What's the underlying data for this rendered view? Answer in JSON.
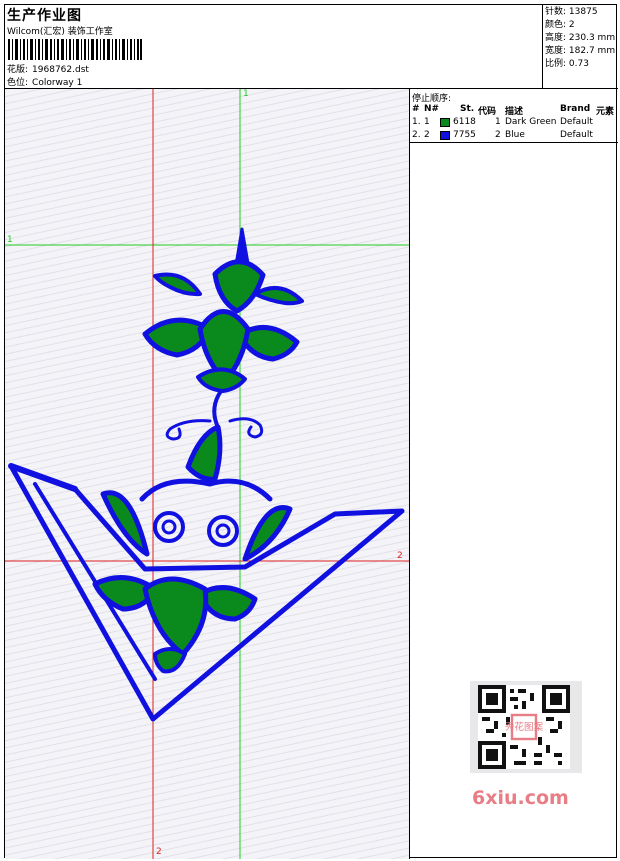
{
  "header": {
    "title": "生产作业图",
    "subtitle": "Wilcom(汇宏) 装饰工作室",
    "design_label": "花版:",
    "design_value": "1968762.dst",
    "colorway_label": "色位:",
    "colorway_value": "Colorway 1"
  },
  "stats": [
    {
      "label": "针数:",
      "value": "13875"
    },
    {
      "label": "颜色:",
      "value": "2"
    },
    {
      "label": "高度:",
      "value": "230.3 mm"
    },
    {
      "label": "宽度:",
      "value": "182.7 mm"
    },
    {
      "label": "比例:",
      "value": "0.73"
    }
  ],
  "stop_sequence": {
    "title": "停止顺序:",
    "columns": [
      "#",
      "N#",
      "St.",
      "代码",
      "描述",
      "Brand",
      "元素"
    ],
    "rows": [
      {
        "num": "1.",
        "n": "1",
        "color": "#0a8a1c",
        "stitches": "6118",
        "code": "1",
        "desc": "Dark Green",
        "brand": "Default"
      },
      {
        "num": "2.",
        "n": "2",
        "color": "#1010e0",
        "stitches": "7755",
        "code": "2",
        "desc": "Blue",
        "brand": "Default"
      }
    ]
  },
  "guides": {
    "h1": "1",
    "h2": "2",
    "v1": "1",
    "v2": "2"
  },
  "watermark": {
    "text": "6xiu.com",
    "qr_stamp": "秀花图案"
  },
  "colors": {
    "green_guide": "#22cc22",
    "red_guide": "#dd2222",
    "thread_green": "#0a8a1c",
    "thread_blue": "#1010e0"
  }
}
